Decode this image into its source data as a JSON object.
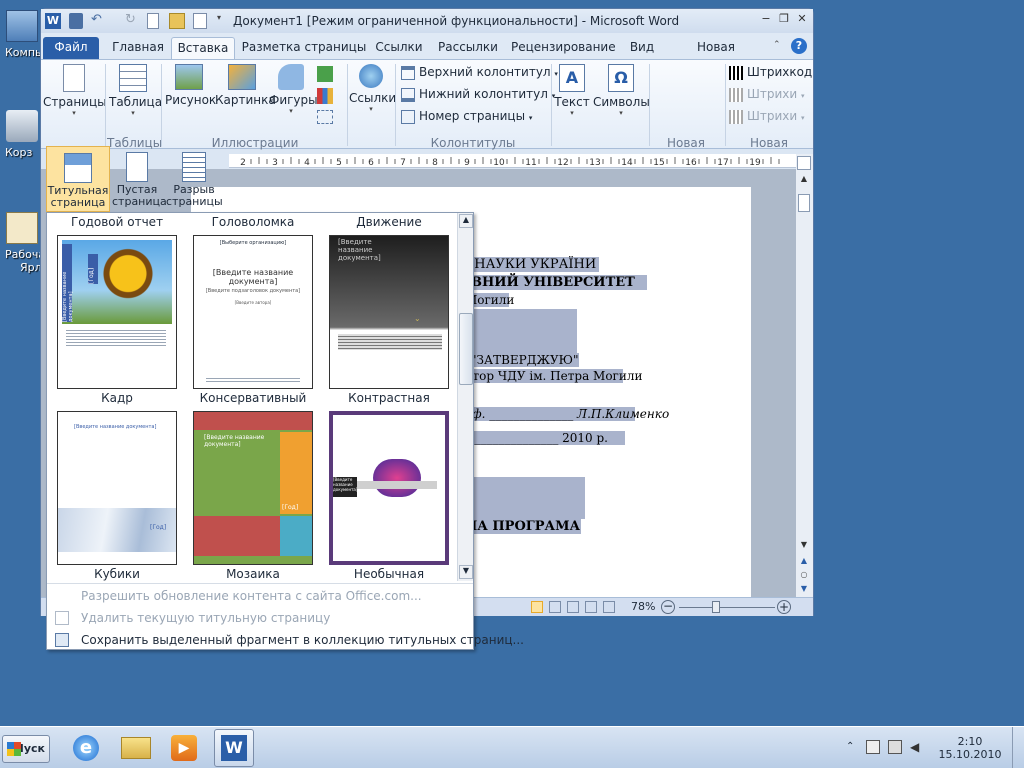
{
  "desktop": {
    "icons": [
      {
        "label": "Компь"
      },
      {
        "label": "Корз"
      },
      {
        "label": "Рабоча"
      },
      {
        "label": "Ярл"
      }
    ]
  },
  "window": {
    "title": "Документ1 [Режим ограниченной функциональности]  -  Microsoft Word",
    "minimize": "−",
    "restore": "❐",
    "close": "✕"
  },
  "tabs": [
    {
      "label": "Файл"
    },
    {
      "label": "Главная"
    },
    {
      "label": "Вставка"
    },
    {
      "label": "Разметка страницы"
    },
    {
      "label": "Ссылки"
    },
    {
      "label": "Рассылки"
    },
    {
      "label": "Рецензирование"
    },
    {
      "label": "Вид"
    },
    {
      "label": "Новая вкладка"
    }
  ],
  "ribbon": {
    "pages": "Страницы",
    "tables": {
      "btn": "Таблица",
      "group": "Таблицы"
    },
    "illustrations": {
      "picture": "Рисунок",
      "clipart": "Картинка",
      "shapes": "Фигуры",
      "group": "Иллюстрации"
    },
    "links": "Ссылки",
    "headerfooter": {
      "header": "Верхний колонтитул",
      "footer": "Нижний колонтитул",
      "pagenum": "Номер страницы",
      "group": "Колонтитулы"
    },
    "text": "Текст",
    "symbols": "Символы",
    "newgroup1": "Новая гру...",
    "barcode": {
      "b1": "Штрихкод",
      "b2": "Штрихи",
      "b3": "Штрихи",
      "group": "Новая группа"
    }
  },
  "pages_menu": {
    "cover": "Титульная\nстраница",
    "blank": "Пустая\nстраница",
    "break": "Разрыв\nстраницы"
  },
  "gallery": {
    "top_labels": [
      "Годовой отчет",
      "Головоломка",
      "Движение"
    ],
    "row1": [
      "Кадр",
      "Консервативный",
      "Контрастная"
    ],
    "row2": [
      "Кубики",
      "Мозаика",
      "Необычная"
    ],
    "thumb_text": {
      "kadr_side": "[Введите название документа]",
      "kadr_year": "[Год]",
      "cons_top": "[Выберите организацию]",
      "cons_title": "[Введите название документа]",
      "cons_sub": "[Введите подзаголовок документа]",
      "cons_small": "[Введите автора]",
      "contr_title": "[Введите название документа]",
      "kub_title": "[Введите название документа]",
      "kub_year": "[Год]",
      "moz_title": "[Введите название документа]",
      "moz_year": "[Год]",
      "neob_title": "[Введите название документа]"
    },
    "menu": [
      {
        "label": "Разрешить обновление контента с сайта Office.com...",
        "disabled": true
      },
      {
        "label": "Удалить текущую титульную страницу",
        "disabled": true
      },
      {
        "label": "Сохранить выделенный фрагмент в коллекцию титульных страниц...",
        "disabled": false
      }
    ]
  },
  "document": {
    "l1": "І  НАУКИ УКРАЇНИ",
    "l2": "ВНИЙ УНІВЕРСИТЕТ",
    "l3": "Могили",
    "l4": "\"ЗАТВЕРДЖУЮ\"",
    "l5": "ктор ЧДУ ім. Петра Могили",
    "l6": "оф. ______________ Л.П.Клименко",
    "l7": "\"  ______________  2010 р.",
    "l8": "НА ПРОГРАМА"
  },
  "ruler": {
    "ticks": [
      "2",
      "3",
      "4",
      "5",
      "6",
      "7",
      "8",
      "9",
      "10",
      "11",
      "12",
      "13",
      "14",
      "15",
      "16",
      "17",
      "19"
    ]
  },
  "status": {
    "zoom": "78%"
  },
  "taskbar": {
    "start": "Пуск",
    "time": "2:10",
    "date": "15.10.2010"
  }
}
